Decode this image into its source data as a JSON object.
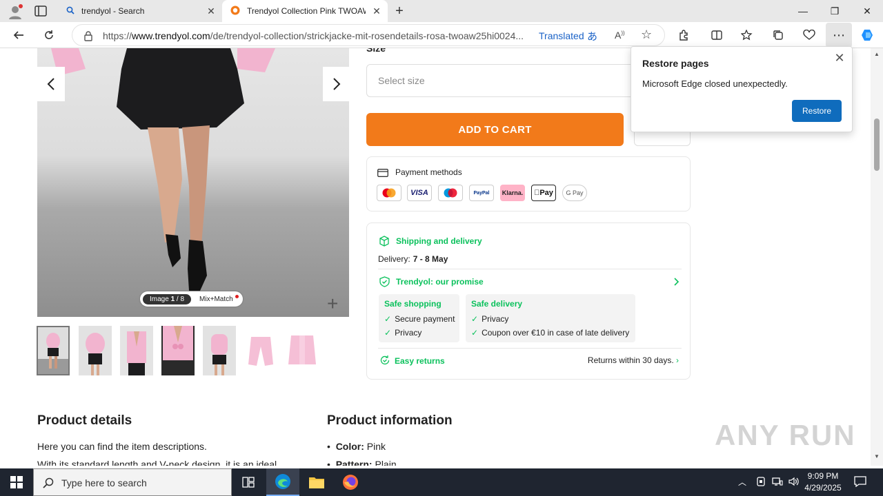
{
  "browser": {
    "tabs": [
      {
        "title": "trendyol - Search"
      },
      {
        "title": "Trendyol Collection Pink TWOAW"
      }
    ],
    "url_prefix": "https://",
    "url_domain": "www.trendyol.com",
    "url_path": "/de/trendyol-collection/strickjacke-mit-rosendetails-rosa-twoaw25hi0024...",
    "translated_label": "Translated"
  },
  "gallery": {
    "counter_prefix": "Image ",
    "counter_current": "1",
    "counter_total": " / 8",
    "mixmatch_label": "Mix+Match"
  },
  "product": {
    "size_label": "Size",
    "size_placeholder": "Select size",
    "add_to_cart": "ADD TO CART"
  },
  "payment": {
    "title": "Payment methods",
    "methods": [
      "Mastercard",
      "VISA",
      "Maestro",
      "PayPal",
      "Klarna.",
      "Apple Pay",
      "G Pay"
    ],
    "visa_text": "VISA",
    "paypal_text": "PayPal",
    "klarna_text": "Klarna.",
    "applepay_text": "Pay",
    "gpay_text": "G Pay"
  },
  "delivery": {
    "shipping_title": "Shipping and delivery",
    "delivery_label": "Delivery:",
    "delivery_dates": "7 - 8 May",
    "promise_title": "Trendyol: our promise",
    "safe_shopping_title": "Safe shopping",
    "safe_shopping_items": [
      "Secure payment",
      "Privacy"
    ],
    "safe_delivery_title": "Safe delivery",
    "safe_delivery_items": [
      "Privacy",
      "Coupon over €10 in case of late delivery"
    ],
    "returns_title": "Easy returns",
    "returns_text": "Returns within 30 days."
  },
  "details": {
    "title": "Product details",
    "line1": "Here you can find the item descriptions.",
    "line2": "With its standard length and V-neck design, it is an ideal"
  },
  "info": {
    "title": "Product information",
    "color_label": "Color:",
    "color_value": " Pink",
    "pattern_label": "Pattern:",
    "pattern_value": " Plain"
  },
  "watermark": "ANY RUN",
  "restore_popup": {
    "title": "Restore pages",
    "message": "Microsoft Edge closed unexpectedly.",
    "button": "Restore"
  },
  "taskbar": {
    "search_placeholder": "Type here to search",
    "time": "9:09 PM",
    "date": "4/29/2025"
  },
  "colors": {
    "brand_orange": "#f27a1a",
    "promise_green": "#0bc15c",
    "edge_blue": "#0f6cbd"
  }
}
